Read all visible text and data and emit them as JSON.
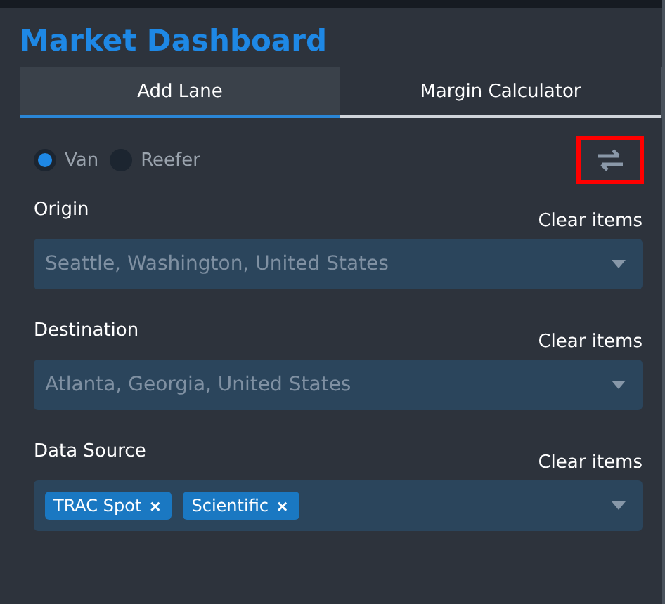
{
  "title": "Market Dashboard",
  "tabs": [
    {
      "label": "Add Lane",
      "selected": true
    },
    {
      "label": "Margin Calculator",
      "selected": false
    }
  ],
  "equipment": [
    {
      "label": "Van",
      "selected": true
    },
    {
      "label": "Reefer",
      "selected": false
    }
  ],
  "swap_button": {
    "highlighted": true
  },
  "fields": [
    {
      "label": "Origin",
      "clear": "Clear items",
      "value": "Seattle, Washington, United States"
    },
    {
      "label": "Destination",
      "clear": "Clear items",
      "value": "Atlanta, Georgia, United States"
    },
    {
      "label": "Data Source",
      "clear": "Clear items",
      "chips": [
        {
          "label": "TRAC Spot",
          "remove": "×"
        },
        {
          "label": "Scientific",
          "remove": "×"
        }
      ]
    }
  ]
}
